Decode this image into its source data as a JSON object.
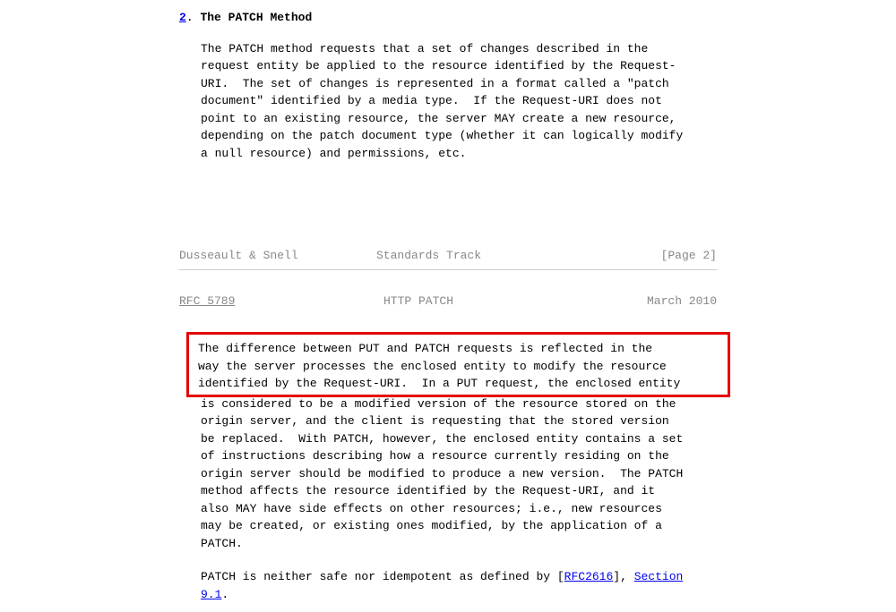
{
  "section": {
    "number_link": "2",
    "dot": ".",
    "title_spacing": "  ",
    "title": "The PATCH Method"
  },
  "para1": "The PATCH method requests that a set of changes described in the\nrequest entity be applied to the resource identified by the Request-\nURI.  The set of changes is represented in a format called a \"patch\ndocument\" identified by a media type.  If the Request-URI does not\npoint to an existing resource, the server MAY create a new resource,\ndepending on the patch document type (whether it can logically modify\na null resource) and permissions, etc.",
  "footer": {
    "authors": "Dusseault & Snell",
    "track": "Standards Track",
    "page": "[Page 2]"
  },
  "header": {
    "rfc": "RFC 5789",
    "title": "HTTP PATCH",
    "date": "March 2010"
  },
  "highlight_text": "The difference between PUT and PATCH requests is reflected in the\nway the server processes the enclosed entity to modify the resource\nidentified by the Request-URI.  In a PUT request, the enclosed entity",
  "para2_rest": "is considered to be a modified version of the resource stored on the\norigin server, and the client is requesting that the stored version\nbe replaced.  With PATCH, however, the enclosed entity contains a set\nof instructions describing how a resource currently residing on the\norigin server should be modified to produce a new version.  The PATCH\nmethod affects the resource identified by the Request-URI, and it\nalso MAY have side effects on other resources; i.e., new resources\nmay be created, or existing ones modified, by the application of a\nPATCH.",
  "para3": {
    "prefix": "PATCH is neither safe nor idempotent as defined by [",
    "rfc_link": "RFC2616",
    "mid": "], ",
    "section_link_pre": "Section\n",
    "section_link": "9.1",
    "suffix": "."
  }
}
